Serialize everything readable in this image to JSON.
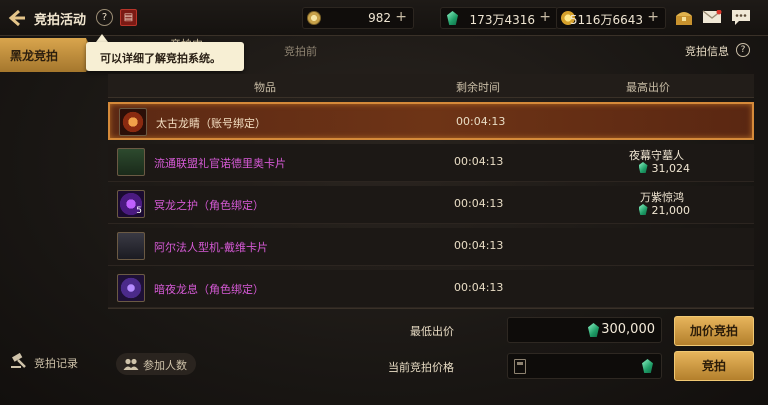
{
  "header": {
    "title": "竞拍活动",
    "help_glyph": "?",
    "currencies": [
      {
        "icon": "gold-coin-icon",
        "value": "982",
        "plus": "+"
      },
      {
        "icon": "green-gem-icon",
        "value": "173万4316",
        "plus": "+"
      },
      {
        "icon": "gold-coin-icon",
        "value": "5116万6643",
        "plus": "+"
      }
    ]
  },
  "sidebar": {
    "tab_label": "黑龙竞拍",
    "record_label": "竞拍记录"
  },
  "tabs": {
    "active": "竞拍中",
    "pre": "竞拍前"
  },
  "tooltip": "可以详细了解竞拍系统。",
  "info_link": "竞拍信息",
  "table": {
    "headers": {
      "item": "物品",
      "time": "剩余时间",
      "bid": "最高出价"
    },
    "rows": [
      {
        "name": "太古龙睛（账号绑定）",
        "time": "00:04:13",
        "bidder": "",
        "amount": "",
        "color": "orange"
      },
      {
        "name": "流通联盟礼官诺德里奥卡片",
        "time": "00:04:13",
        "bidder": "夜幕守墓人",
        "amount": "31,024",
        "color": "pink"
      },
      {
        "name": "冥龙之护（角色绑定）",
        "time": "00:04:13",
        "bidder": "万紫惊鸿",
        "amount": "21,000",
        "color": "pink",
        "badge": "5"
      },
      {
        "name": "阿尔法人型机-戴维卡片",
        "time": "00:04:13",
        "bidder": "",
        "amount": "",
        "color": "pink"
      },
      {
        "name": "暗夜龙息（角色绑定）",
        "time": "00:04:13",
        "bidder": "",
        "amount": "",
        "color": "pink"
      }
    ]
  },
  "footer": {
    "participants_label": "参加人数",
    "min_bid_label": "最低出价",
    "min_bid_value": "300,000",
    "current_bid_label": "当前竞拍价格",
    "current_bid_value": "",
    "raise_button": "加价竞拍",
    "bid_button": "竞拍"
  },
  "colors": {
    "accent_gold": "#d9a54d",
    "item_pink": "#d65ad6",
    "selected_border": "#d58a3a"
  }
}
